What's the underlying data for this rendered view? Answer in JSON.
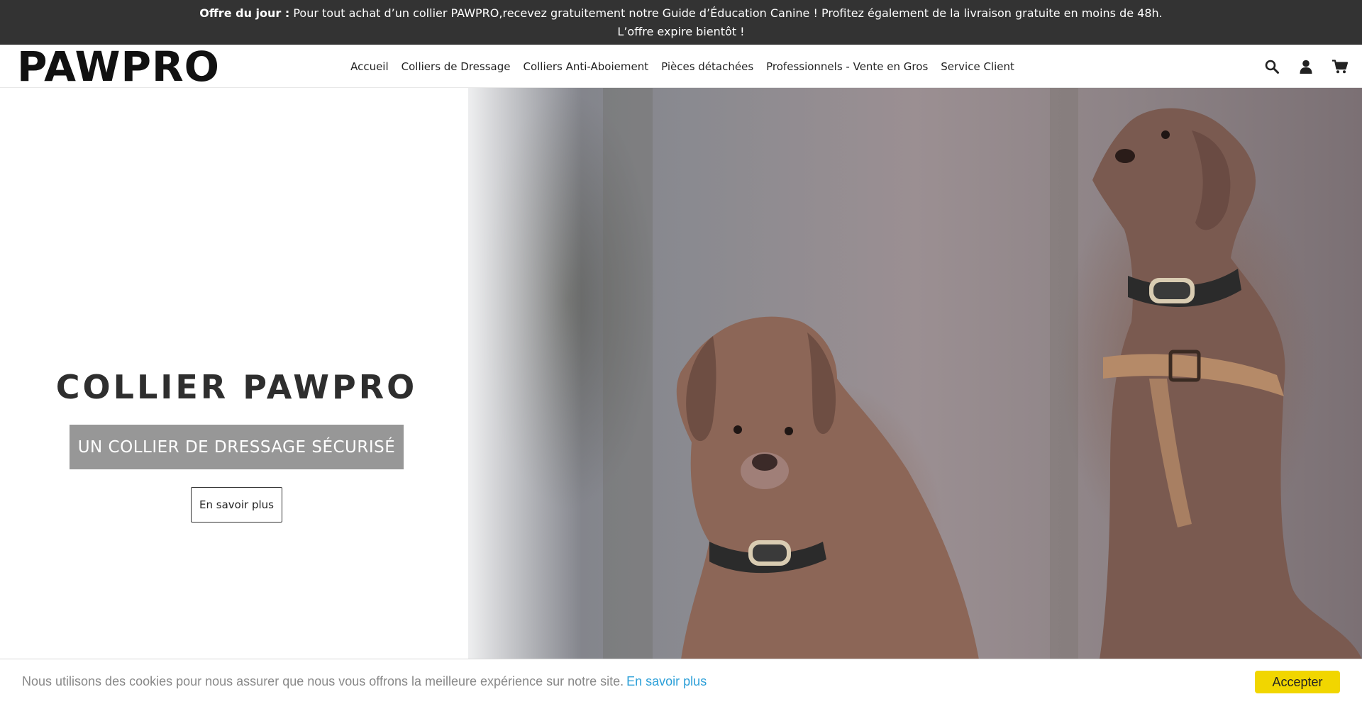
{
  "announcement": {
    "bold": "Offre du jour :",
    "text": " Pour tout achat d’un collier PAWPRO,recevez gratuitement notre Guide d’Éducation Canine ! Profitez également de la livraison gratuite en moins de 48h. L’offre expire bientôt !"
  },
  "header": {
    "logo": "PAWPRO",
    "nav": [
      {
        "label": "Accueil"
      },
      {
        "label": "Colliers de Dressage"
      },
      {
        "label": "Colliers Anti-Aboiement"
      },
      {
        "label": "Pièces détachées"
      },
      {
        "label": "Professionnels - Vente en Gros"
      },
      {
        "label": "Service Client"
      }
    ],
    "icons": [
      "search-icon",
      "user-icon",
      "cart-icon"
    ]
  },
  "hero": {
    "title": "COLLIER PAWPRO",
    "subtitle": "UN COLLIER DE DRESSAGE SÉCURISÉ",
    "cta": "En savoir plus"
  },
  "cookie": {
    "text": "Nous utilisons des cookies pour nous assurer que nous vous offrons la meilleure expérience sur notre site.",
    "link": "En savoir plus",
    "accept": "Accepter",
    "link_color": "#2b9fd8",
    "button_color": "#f1d600"
  },
  "colors": {
    "announcement_bg": "#333333",
    "subtitle_bg": "#979797"
  }
}
